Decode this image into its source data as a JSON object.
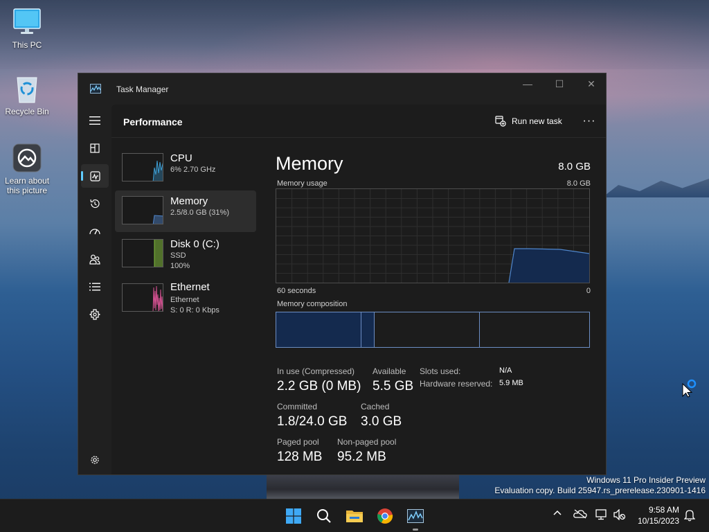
{
  "desktop": {
    "icons": [
      {
        "label": "This PC"
      },
      {
        "label": "Recycle Bin"
      },
      {
        "label": "Learn about this picture"
      }
    ],
    "watermark": {
      "line1": "Windows 11 Pro Insider Preview",
      "line2": "Evaluation copy. Build 25947.rs_prerelease.230901-1416"
    }
  },
  "window": {
    "title": "Task Manager",
    "controls": {
      "minimize": "—",
      "maximize": "☐",
      "close": "✕"
    }
  },
  "nav": {
    "items": [
      {
        "icon": "hamburger-menu-icon"
      },
      {
        "icon": "processes-icon"
      },
      {
        "icon": "performance-icon",
        "active": true
      },
      {
        "icon": "app-history-icon"
      },
      {
        "icon": "startup-apps-icon"
      },
      {
        "icon": "users-icon"
      },
      {
        "icon": "details-icon"
      },
      {
        "icon": "services-icon"
      },
      {
        "icon": "settings-icon"
      }
    ]
  },
  "toolbar": {
    "page_title": "Performance",
    "run_new_task": "Run new task",
    "more": "···"
  },
  "perf_list": [
    {
      "name": "CPU",
      "sub1": "6% 2.70 GHz",
      "sub2": "",
      "color": "#3c9fd6"
    },
    {
      "name": "Memory",
      "sub1": "2.5/8.0 GB (31%)",
      "sub2": "",
      "color": "#4f86cc"
    },
    {
      "name": "Disk 0 (C:)",
      "sub1": "SSD",
      "sub2": "100%",
      "color": "#7fba3a"
    },
    {
      "name": "Ethernet",
      "sub1": "Ethernet",
      "sub2": "S: 0 R: 0 Kbps",
      "color": "#d0508f"
    }
  ],
  "memory": {
    "title": "Memory",
    "total": "8.0 GB",
    "usage_label": "Memory usage",
    "usage_max": "8.0 GB",
    "time_left": "60 seconds",
    "time_right": "0",
    "composition_label": "Memory composition",
    "stats": {
      "in_use_label": "In use (Compressed)",
      "in_use_value": "2.2 GB (0 MB)",
      "available_label": "Available",
      "available_value": "5.5 GB",
      "committed_label": "Committed",
      "committed_value": "1.8/24.0 GB",
      "cached_label": "Cached",
      "cached_value": "3.0 GB",
      "paged_label": "Paged pool",
      "paged_value": "128 MB",
      "nonpaged_label": "Non-paged pool",
      "nonpaged_value": "95.2 MB",
      "slots_label": "Slots used:",
      "slots_value": "N/A",
      "hw_reserved_label": "Hardware reserved:",
      "hw_reserved_value": "5.9 MB"
    }
  },
  "taskbar": {
    "apps": [
      "windows-start-icon",
      "search-icon",
      "file-explorer-icon",
      "chrome-icon",
      "task-manager-icon"
    ],
    "tray": [
      "chevron-up-icon",
      "onedrive-icon",
      "network-icon",
      "volume-muted-icon"
    ],
    "time": "9:58 AM",
    "date": "10/15/2023"
  }
}
